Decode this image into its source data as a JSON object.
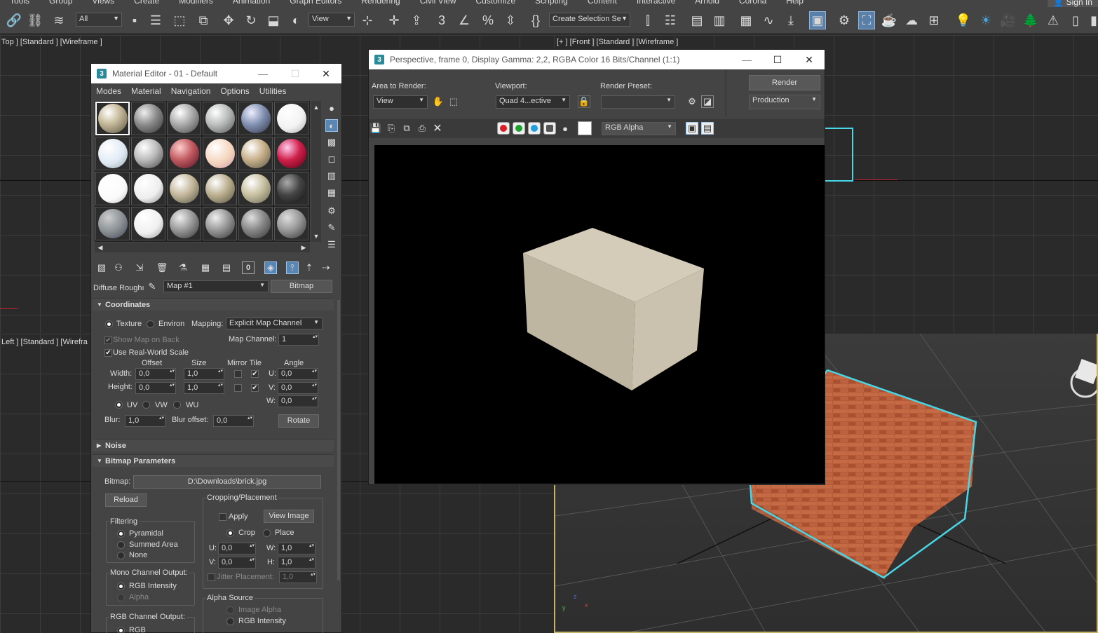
{
  "menubar": [
    "Tools",
    "Group",
    "Views",
    "Create",
    "Modifiers",
    "Animation",
    "Graph Editors",
    "Rendering",
    "Civil View",
    "Customize",
    "Scripting",
    "Content",
    "Interactive",
    "Arnold",
    "Corona",
    "Help"
  ],
  "signin": "Sign In",
  "toolbar": {
    "filter": "All",
    "view": "View",
    "selection_set": "Create Selection Se"
  },
  "viewports": {
    "top": "Top ] [Standard ] [Wireframe ]",
    "front": "[+ ] [Front ] [Standard ] [Wireframe ]",
    "left": "Left ] [Standard ] [Wirefra",
    "gizmo": {
      "x": "x",
      "y": "y",
      "z": "z"
    }
  },
  "material_editor": {
    "title": "Material Editor - 01 - Default",
    "menu": [
      "Modes",
      "Material",
      "Navigation",
      "Options",
      "Utilities"
    ],
    "map_label": "Diffuse Roughı",
    "map_name": "Map #1",
    "map_type": "Bitmap",
    "coords": {
      "title": "Coordinates",
      "texture": "Texture",
      "environ": "Environ",
      "mapping_label": "Mapping:",
      "mapping": "Explicit Map Channel",
      "show_map_on_back": "Show Map on Back",
      "map_channel_label": "Map Channel:",
      "map_channel": "1",
      "real_world": "Use Real-World Scale",
      "h_offset": "Offset",
      "h_size": "Size",
      "h_mirror": "Mirror Tile",
      "h_angle": "Angle",
      "width_label": "Width:",
      "height_label": "Height:",
      "width_offset": "0,0",
      "width_size": "1,0",
      "height_offset": "0,0",
      "height_size": "1,0",
      "u_label": "U:",
      "v_label": "V:",
      "w_label": "W:",
      "angle_u": "0,0",
      "angle_v": "0,0",
      "angle_w": "0,0",
      "uv": "UV",
      "vw": "VW",
      "wu": "WU",
      "blur_label": "Blur:",
      "blur": "1,0",
      "blur_offset_label": "Blur offset:",
      "blur_offset": "0,0",
      "rotate": "Rotate"
    },
    "noise": "Noise",
    "bitmap_params": {
      "title": "Bitmap Parameters",
      "bitmap_label": "Bitmap:",
      "path": "D:\\Downloads\\brick.jpg",
      "reload": "Reload",
      "cropping": "Cropping/Placement",
      "apply": "Apply",
      "view_image": "View Image",
      "crop": "Crop",
      "place": "Place",
      "u": "0,0",
      "w": "1,0",
      "v": "0,0",
      "h": "1,0",
      "u_label": "U:",
      "w_label": "W:",
      "v_label": "V:",
      "h_label": "H:",
      "jitter": "Jitter Placement:",
      "jitter_val": "1,0",
      "filtering": "Filtering",
      "pyramidal": "Pyramidal",
      "summed": "Summed Area",
      "none": "None",
      "mono": "Mono Channel Output:",
      "rgb_intensity": "RGB Intensity",
      "alpha": "Alpha",
      "rgb_out": "RGB Channel Output:",
      "rgb": "RGB",
      "alpha_source": "Alpha Source",
      "image_alpha": "Image Alpha",
      "rgb_intensity2": "RGB Intensity"
    }
  },
  "render_frame": {
    "title": "Perspective, frame 0, Display Gamma: 2,2, RGBA Color 16 Bits/Channel (1:1)",
    "area_label": "Area to Render:",
    "area": "View",
    "viewport_label": "Viewport:",
    "viewport": "Quad 4...ective",
    "preset_label": "Render Preset:",
    "preset": "",
    "render_btn": "Render",
    "production": "Production",
    "channel": "RGB Alpha"
  },
  "colors": {
    "accent": "#5a86b4",
    "selection": "#49d6e6",
    "box": "#c8bfae",
    "brick": "#b2593a"
  }
}
